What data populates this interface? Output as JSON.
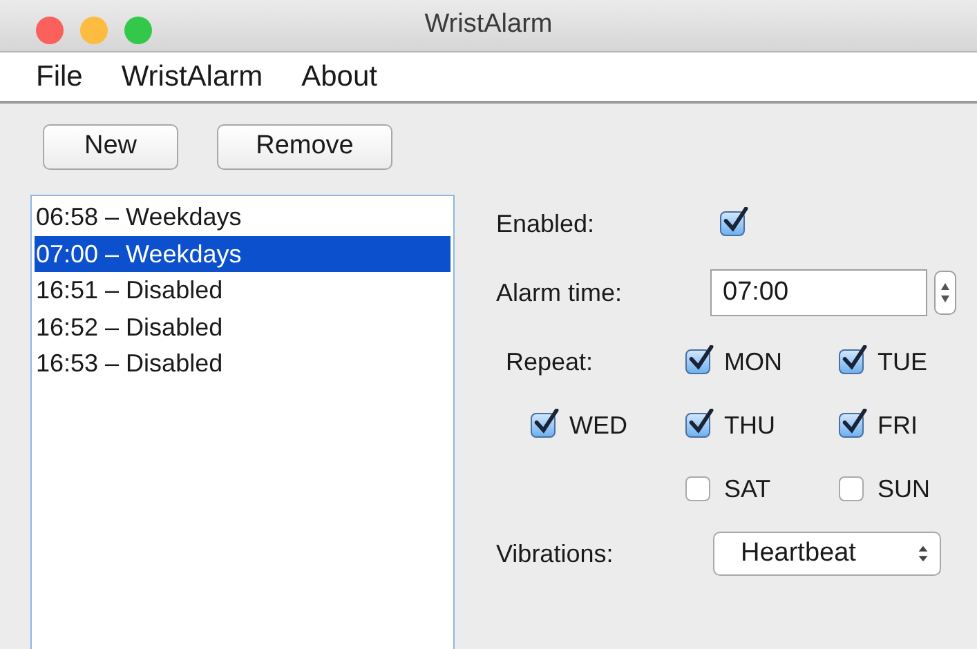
{
  "window": {
    "title": "WristAlarm"
  },
  "menu": [
    "File",
    "WristAlarm",
    "About"
  ],
  "buttons": [
    "New",
    "Remove"
  ],
  "alarms": [
    {
      "label": "06:58 – Weekdays",
      "selected": false
    },
    {
      "label": "07:00 – Weekdays",
      "selected": true
    },
    {
      "label": "16:51 – Disabled",
      "selected": false
    },
    {
      "label": "16:52 – Disabled",
      "selected": false
    },
    {
      "label": "16:53 – Disabled",
      "selected": false
    }
  ],
  "enabled": {
    "label": "Enabled:",
    "checked": true
  },
  "alarm_time": {
    "label": "Alarm time:",
    "value": "07:00"
  },
  "repeat": {
    "label": "Repeat:",
    "days": [
      {
        "label": "MON",
        "checked": true
      },
      {
        "label": "TUE",
        "checked": true
      },
      {
        "label": "WED",
        "checked": true
      },
      {
        "label": "THU",
        "checked": true
      },
      {
        "label": "FRI",
        "checked": true
      },
      {
        "label": "SAT",
        "checked": false
      },
      {
        "label": "SUN",
        "checked": false
      }
    ]
  },
  "vibrations": {
    "label": "Vibrations:",
    "value": "Heartbeat"
  }
}
